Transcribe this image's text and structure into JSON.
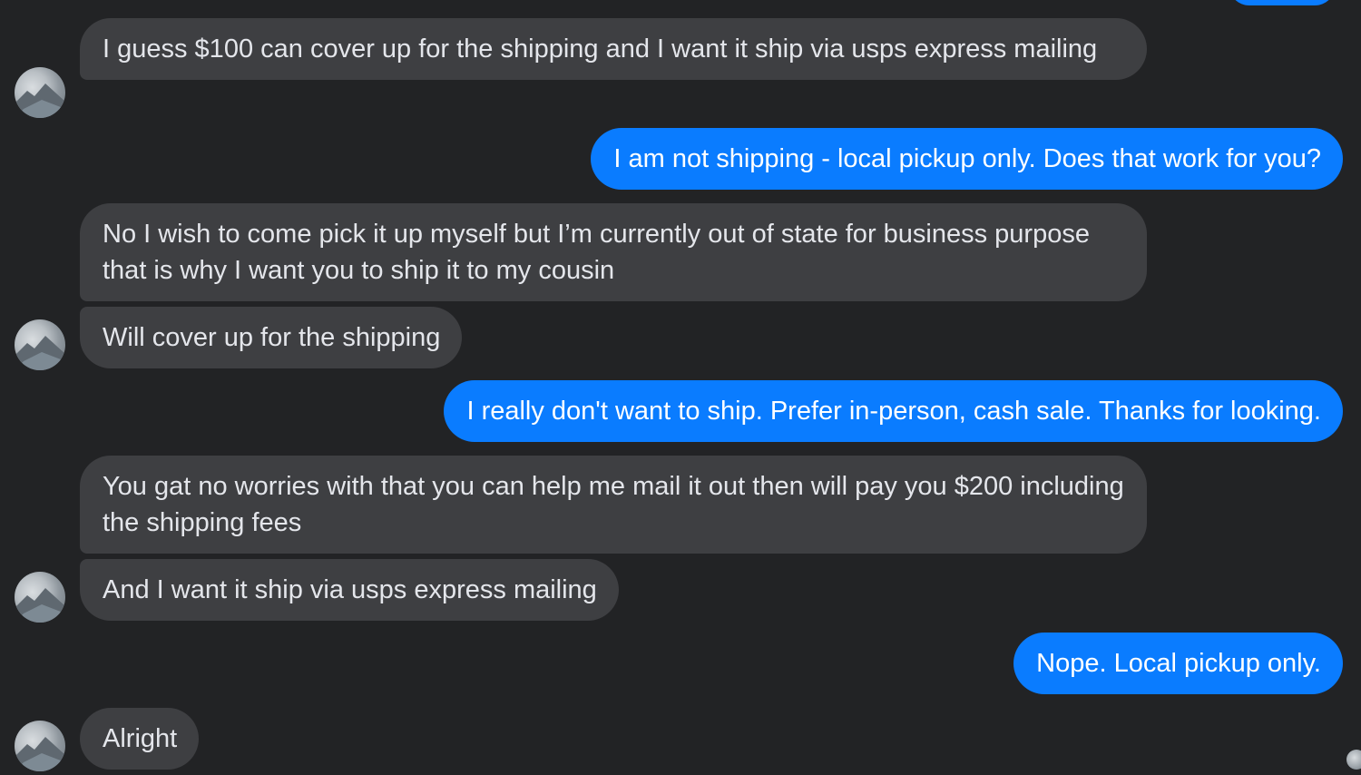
{
  "messages": [
    {
      "sender": "them",
      "text": "I guess $100 can cover up for the shipping and I want it ship via usps express mailing"
    },
    {
      "sender": "me",
      "text": "I am not shipping - local pickup only. Does that work for you?"
    },
    {
      "sender": "them",
      "text": "No I wish to come pick it up myself but I’m currently out of state for business purpose that is why I want you to ship it to my cousin"
    },
    {
      "sender": "them",
      "text": "Will cover up for the shipping"
    },
    {
      "sender": "me",
      "text": "I really don't want to ship. Prefer in-person, cash sale. Thanks for looking."
    },
    {
      "sender": "them",
      "text": "You gat no worries with that you can help me mail it out then will pay you $200 including the shipping fees"
    },
    {
      "sender": "them",
      "text": "And I want it ship via usps express mailing"
    },
    {
      "sender": "me",
      "text": "Nope. Local pickup only."
    },
    {
      "sender": "them",
      "text": "Alright"
    }
  ],
  "colors": {
    "background": "#222325",
    "incoming_bubble": "#3e3f42",
    "outgoing_bubble": "#0a7cff",
    "incoming_text": "#e4e6eb",
    "outgoing_text": "#ffffff"
  },
  "icons": {
    "contact_avatar": "contact-avatar",
    "read_receipt": "seen-avatar-icon"
  }
}
